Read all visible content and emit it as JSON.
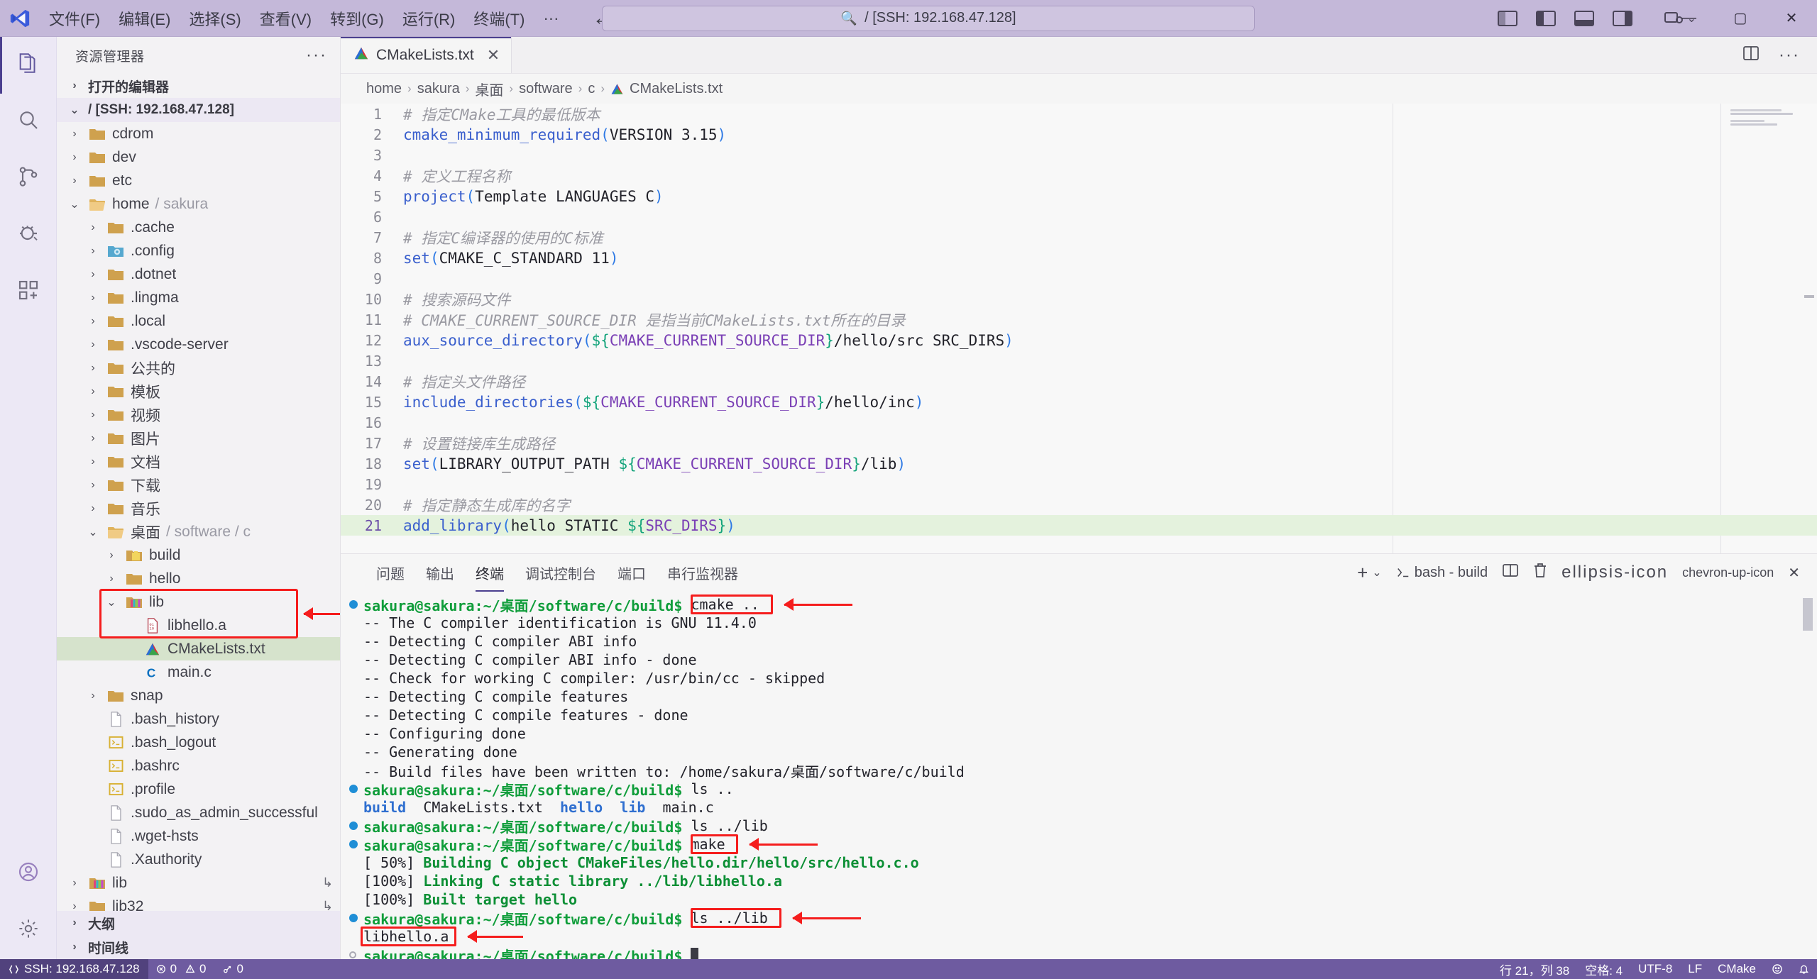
{
  "titlebar": {
    "menu": [
      "文件(F)",
      "编辑(E)",
      "选择(S)",
      "查看(V)",
      "转到(G)",
      "运行(R)",
      "终端(T)",
      "···"
    ],
    "back_icon": "arrow-left-icon",
    "forward_icon": "arrow-right-icon",
    "quick_input": "/ [SSH: 192.168.47.128]",
    "quick_input_icon": "search-icon",
    "window_controls": {
      "minimize": "—",
      "maximize": "▢",
      "close": "✕"
    }
  },
  "activitybar": {
    "items": [
      {
        "name": "explorer",
        "icon": "files-icon"
      },
      {
        "name": "search",
        "icon": "search-icon"
      },
      {
        "name": "source-control",
        "icon": "source-control-icon"
      },
      {
        "name": "run-debug",
        "icon": "run-debug-icon"
      },
      {
        "name": "extensions",
        "icon": "extensions-icon"
      }
    ],
    "bottom": [
      {
        "name": "accounts",
        "icon": "account-icon"
      },
      {
        "name": "settings",
        "icon": "gear-icon"
      }
    ]
  },
  "sidebar": {
    "title": "资源管理器",
    "more_icon": "ellipsis-icon",
    "sections": {
      "open_editors": "打开的编辑器",
      "workspace": "/ [SSH: 192.168.47.128]",
      "outline": "大纲",
      "timeline": "时间线"
    },
    "tree": [
      {
        "label": "cdrom",
        "indent": 1,
        "chev": "›",
        "icon": "folder",
        "type": "folder"
      },
      {
        "label": "dev",
        "indent": 1,
        "chev": "›",
        "icon": "folder",
        "type": "folder"
      },
      {
        "label": "etc",
        "indent": 1,
        "chev": "›",
        "icon": "folder",
        "type": "folder"
      },
      {
        "label": "home",
        "suffix": "/ sakura",
        "indent": 1,
        "chev": "⌄",
        "icon": "folder-open",
        "type": "folder"
      },
      {
        "label": ".cache",
        "indent": 2,
        "chev": "›",
        "icon": "folder",
        "type": "folder"
      },
      {
        "label": ".config",
        "indent": 2,
        "chev": "›",
        "icon": "folder-config",
        "type": "folder"
      },
      {
        "label": ".dotnet",
        "indent": 2,
        "chev": "›",
        "icon": "folder",
        "type": "folder"
      },
      {
        "label": ".lingma",
        "indent": 2,
        "chev": "›",
        "icon": "folder",
        "type": "folder"
      },
      {
        "label": ".local",
        "indent": 2,
        "chev": "›",
        "icon": "folder",
        "type": "folder"
      },
      {
        "label": ".vscode-server",
        "indent": 2,
        "chev": "›",
        "icon": "folder",
        "type": "folder"
      },
      {
        "label": "公共的",
        "indent": 2,
        "chev": "›",
        "icon": "folder",
        "type": "folder"
      },
      {
        "label": "模板",
        "indent": 2,
        "chev": "›",
        "icon": "folder",
        "type": "folder"
      },
      {
        "label": "视频",
        "indent": 2,
        "chev": "›",
        "icon": "folder",
        "type": "folder"
      },
      {
        "label": "图片",
        "indent": 2,
        "chev": "›",
        "icon": "folder",
        "type": "folder"
      },
      {
        "label": "文档",
        "indent": 2,
        "chev": "›",
        "icon": "folder",
        "type": "folder"
      },
      {
        "label": "下载",
        "indent": 2,
        "chev": "›",
        "icon": "folder",
        "type": "folder"
      },
      {
        "label": "音乐",
        "indent": 2,
        "chev": "›",
        "icon": "folder",
        "type": "folder"
      },
      {
        "label": "桌面",
        "suffix": "/ software / c",
        "indent": 2,
        "chev": "⌄",
        "icon": "folder-open",
        "type": "folder"
      },
      {
        "label": "build",
        "indent": 3,
        "chev": "›",
        "icon": "folder-build",
        "type": "folder"
      },
      {
        "label": "hello",
        "indent": 3,
        "chev": "›",
        "icon": "folder",
        "type": "folder"
      },
      {
        "label": "lib",
        "indent": 3,
        "chev": "⌄",
        "icon": "folder-lib",
        "type": "folder"
      },
      {
        "label": "libhello.a",
        "indent": 4,
        "chev": "",
        "icon": "binary-file",
        "type": "file"
      },
      {
        "label": "CMakeLists.txt",
        "indent": 4,
        "chev": "",
        "icon": "cmake-file",
        "type": "file",
        "selected": true
      },
      {
        "label": "main.c",
        "indent": 4,
        "chev": "",
        "icon": "c-file",
        "type": "file"
      },
      {
        "label": "snap",
        "indent": 2,
        "chev": "›",
        "icon": "folder",
        "type": "folder"
      },
      {
        "label": ".bash_history",
        "indent": 2,
        "chev": "",
        "icon": "plain-file",
        "type": "file"
      },
      {
        "label": ".bash_logout",
        "indent": 2,
        "chev": "",
        "icon": "shell-file",
        "type": "file"
      },
      {
        "label": ".bashrc",
        "indent": 2,
        "chev": "",
        "icon": "shell-file",
        "type": "file"
      },
      {
        "label": ".profile",
        "indent": 2,
        "chev": "",
        "icon": "shell-file",
        "type": "file"
      },
      {
        "label": ".sudo_as_admin_successful",
        "indent": 2,
        "chev": "",
        "icon": "plain-file",
        "type": "file"
      },
      {
        "label": ".wget-hsts",
        "indent": 2,
        "chev": "",
        "icon": "plain-file",
        "type": "file"
      },
      {
        "label": ".Xauthority",
        "indent": 2,
        "chev": "",
        "icon": "plain-file",
        "type": "file"
      },
      {
        "label": "lib",
        "indent": 1,
        "chev": "›",
        "icon": "folder-lib",
        "type": "folder",
        "symlink": "↳"
      },
      {
        "label": "lib32",
        "indent": 1,
        "chev": "›",
        "icon": "folder",
        "type": "folder",
        "symlink": "↳"
      }
    ]
  },
  "editor": {
    "tab": {
      "label": "CMakeLists.txt",
      "icon": "cmake-file",
      "close": "✕"
    },
    "tab_actions": {
      "split": "split-editor-icon",
      "more": "ellipsis-icon"
    },
    "breadcrumb": [
      "home",
      "sakura",
      "桌面",
      "software",
      "c",
      "CMakeLists.txt"
    ],
    "breadcrumb_sep": "›",
    "lines": [
      {
        "n": 1,
        "tokens": [
          {
            "t": "# 指定CMake工具的最低版本",
            "c": "cm"
          }
        ]
      },
      {
        "n": 2,
        "tokens": [
          {
            "t": "cmake_minimum_required",
            "c": "fn"
          },
          {
            "t": "(",
            "c": "pn"
          },
          {
            "t": "VERSION 3.15",
            "c": "tx"
          },
          {
            "t": ")",
            "c": "pn"
          }
        ]
      },
      {
        "n": 3,
        "tokens": []
      },
      {
        "n": 4,
        "tokens": [
          {
            "t": "# 定义工程名称",
            "c": "cm"
          }
        ]
      },
      {
        "n": 5,
        "tokens": [
          {
            "t": "project",
            "c": "fn"
          },
          {
            "t": "(",
            "c": "pn"
          },
          {
            "t": "Template LANGUAGES C",
            "c": "tx"
          },
          {
            "t": ")",
            "c": "pn"
          }
        ]
      },
      {
        "n": 6,
        "tokens": []
      },
      {
        "n": 7,
        "tokens": [
          {
            "t": "# 指定C编译器的使用的C标准",
            "c": "cm"
          }
        ]
      },
      {
        "n": 8,
        "tokens": [
          {
            "t": "set",
            "c": "fn"
          },
          {
            "t": "(",
            "c": "pn"
          },
          {
            "t": "CMAKE_C_STANDARD 11",
            "c": "tx"
          },
          {
            "t": ")",
            "c": "pn"
          }
        ]
      },
      {
        "n": 9,
        "tokens": []
      },
      {
        "n": 10,
        "tokens": [
          {
            "t": "# 搜索源码文件",
            "c": "cm"
          }
        ]
      },
      {
        "n": 11,
        "tokens": [
          {
            "t": "# CMAKE_CURRENT_SOURCE_DIR 是指当前CMakeLists.txt所在的目录",
            "c": "cm"
          }
        ]
      },
      {
        "n": 12,
        "tokens": [
          {
            "t": "aux_source_directory",
            "c": "fn"
          },
          {
            "t": "(",
            "c": "pn"
          },
          {
            "t": "${",
            "c": "vr"
          },
          {
            "t": "CMAKE_CURRENT_SOURCE_DIR",
            "c": "pl"
          },
          {
            "t": "}",
            "c": "vr"
          },
          {
            "t": "/hello/src SRC_DIRS",
            "c": "tx"
          },
          {
            "t": ")",
            "c": "pn"
          }
        ]
      },
      {
        "n": 13,
        "tokens": []
      },
      {
        "n": 14,
        "tokens": [
          {
            "t": "# 指定头文件路径",
            "c": "cm"
          }
        ]
      },
      {
        "n": 15,
        "tokens": [
          {
            "t": "include_directories",
            "c": "fn"
          },
          {
            "t": "(",
            "c": "pn"
          },
          {
            "t": "${",
            "c": "vr"
          },
          {
            "t": "CMAKE_CURRENT_SOURCE_DIR",
            "c": "pl"
          },
          {
            "t": "}",
            "c": "vr"
          },
          {
            "t": "/hello/inc",
            "c": "tx"
          },
          {
            "t": ")",
            "c": "pn"
          }
        ]
      },
      {
        "n": 16,
        "tokens": []
      },
      {
        "n": 17,
        "tokens": [
          {
            "t": "# 设置链接库生成路径",
            "c": "cm"
          }
        ]
      },
      {
        "n": 18,
        "tokens": [
          {
            "t": "set",
            "c": "fn"
          },
          {
            "t": "(",
            "c": "pn"
          },
          {
            "t": "LIBRARY_OUTPUT_PATH ",
            "c": "tx"
          },
          {
            "t": "${",
            "c": "vr"
          },
          {
            "t": "CMAKE_CURRENT_SOURCE_DIR",
            "c": "pl"
          },
          {
            "t": "}",
            "c": "vr"
          },
          {
            "t": "/lib",
            "c": "tx"
          },
          {
            "t": ")",
            "c": "pn"
          }
        ]
      },
      {
        "n": 19,
        "tokens": []
      },
      {
        "n": 20,
        "tokens": [
          {
            "t": "# 指定静态生成库的名字",
            "c": "cm"
          }
        ]
      },
      {
        "n": 21,
        "highlight": true,
        "tokens": [
          {
            "t": "add_library",
            "c": "fn"
          },
          {
            "t": "(",
            "c": "pn"
          },
          {
            "t": "hello STATIC ",
            "c": "tx"
          },
          {
            "t": "${",
            "c": "vr"
          },
          {
            "t": "SRC_DIRS",
            "c": "pl"
          },
          {
            "t": "}",
            "c": "vr"
          },
          {
            "t": ")",
            "c": "pn"
          }
        ]
      }
    ]
  },
  "panel": {
    "tabs": [
      "问题",
      "输出",
      "终端",
      "调试控制台",
      "端口",
      "串行监视器"
    ],
    "active_tab": "终端",
    "actions": {
      "new_terminal": "+",
      "dropdown": "⌄",
      "shell_name": "bash - build",
      "shell_icon": "terminal-icon",
      "split": "split-icon",
      "kill": "trash-icon",
      "more": "ellipsis-icon",
      "maximize": "chevron-up-icon",
      "close": "✕"
    },
    "prompt": "sakura@sakura:~/桌面/software/c/build$",
    "terminal_lines": [
      {
        "kind": "prompt",
        "cmd": "cmake ..",
        "boxed": true,
        "arrow": true
      },
      {
        "kind": "out",
        "text": "-- The C compiler identification is GNU 11.4.0"
      },
      {
        "kind": "out",
        "text": "-- Detecting C compiler ABI info"
      },
      {
        "kind": "out",
        "text": "-- Detecting C compiler ABI info - done"
      },
      {
        "kind": "out",
        "text": "-- Check for working C compiler: /usr/bin/cc - skipped"
      },
      {
        "kind": "out",
        "text": "-- Detecting C compile features"
      },
      {
        "kind": "out",
        "text": "-- Detecting C compile features - done"
      },
      {
        "kind": "out",
        "text": "-- Configuring done"
      },
      {
        "kind": "out",
        "text": "-- Generating done"
      },
      {
        "kind": "out",
        "text": "-- Build files have been written to: /home/sakura/桌面/software/c/build"
      },
      {
        "kind": "prompt",
        "cmd": "ls .."
      },
      {
        "kind": "ls",
        "text": "build  CMakeLists.txt  hello  lib  main.c"
      },
      {
        "kind": "prompt",
        "cmd": "ls ../lib"
      },
      {
        "kind": "prompt",
        "cmd": "make",
        "boxed": true,
        "arrow": true
      },
      {
        "kind": "make",
        "pct": "[ 50%]",
        "text": " Building C object CMakeFiles/hello.dir/hello/src/hello.c.o"
      },
      {
        "kind": "make",
        "pct": "[100%]",
        "text": " Linking C static library ../lib/libhello.a"
      },
      {
        "kind": "make",
        "pct": "[100%]",
        "text": " Built target hello"
      },
      {
        "kind": "prompt",
        "cmd": "ls ../lib",
        "boxed": true,
        "arrow": true
      },
      {
        "kind": "result",
        "text": "libhello.a",
        "boxed": true,
        "arrow": true
      },
      {
        "kind": "prompt-empty",
        "cmd": ""
      }
    ]
  },
  "statusbar": {
    "remote": "SSH: 192.168.47.128",
    "remote_icon": "remote-icon",
    "errors": "0",
    "warnings": "0",
    "ports": "0",
    "error_icon": "error-icon",
    "warning_icon": "warning-icon",
    "ports_icon": "ports-icon",
    "position": "行 21，列 38",
    "indent": "空格: 4",
    "encoding": "UTF-8",
    "eol": "LF",
    "language": "CMake",
    "feedback_icon": "smiley-icon",
    "bell_icon": "bell-icon"
  }
}
